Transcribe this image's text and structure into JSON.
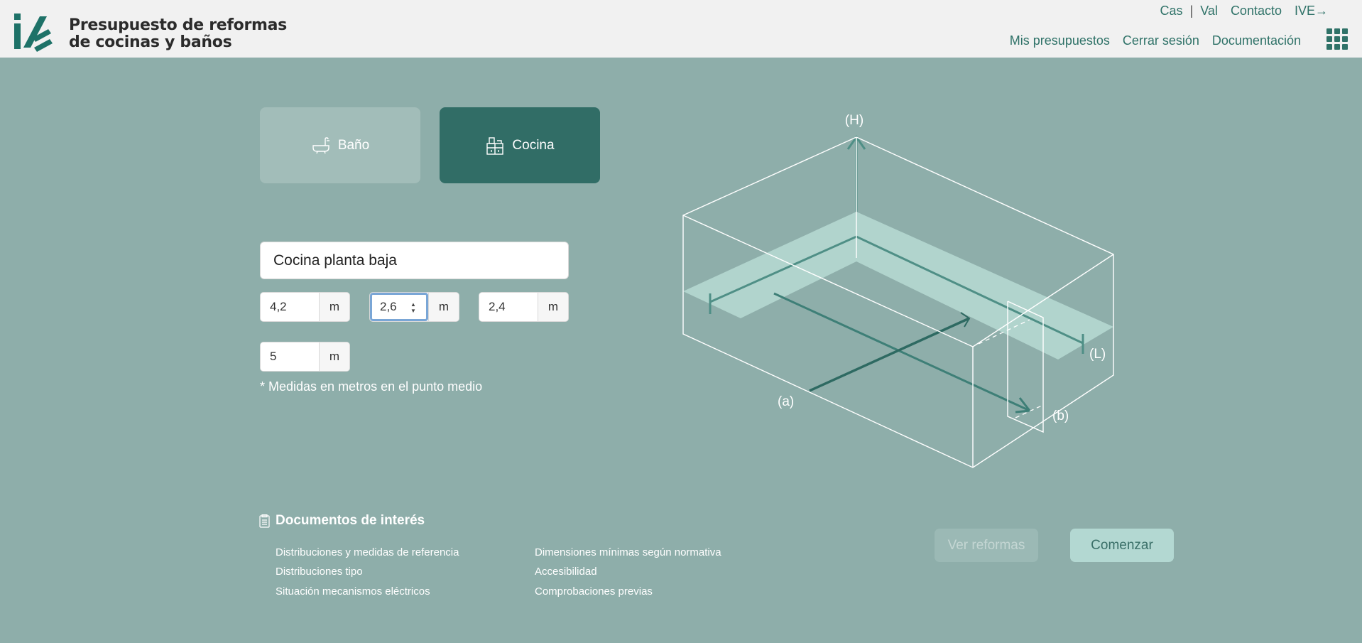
{
  "header": {
    "title_line1": "Presupuesto de reformas",
    "title_line2": "de cocinas y baños",
    "lang_cas": "Cas",
    "lang_sep": "|",
    "lang_val": "Val",
    "contacto": "Contacto",
    "ive": "IVE→",
    "nav": [
      "Mis presupuestos",
      "Cerrar sesión",
      "Documentación"
    ],
    "brand_color": "#2f7268"
  },
  "type_selector": {
    "bano_label": "Baño",
    "cocina_label": "Cocina",
    "selected": "Cocina"
  },
  "form": {
    "name_value": "Cocina planta baja",
    "dimensions": [
      {
        "value": "4,2",
        "unit": "m"
      },
      {
        "value": "2,6",
        "unit": "m"
      },
      {
        "value": "2,4",
        "unit": "m"
      },
      {
        "value": "5",
        "unit": "m"
      }
    ],
    "note": "* Medidas en metros en el punto medio"
  },
  "diagram": {
    "label_h": "(H)",
    "label_l": "(L)",
    "label_a": "(a)",
    "label_b": "(b)"
  },
  "documents": {
    "title": "Documentos de interés",
    "links_col1": [
      "Distribuciones y medidas de referencia",
      "Distribuciones tipo",
      "Situación mecanismos eléctricos"
    ],
    "links_col2": [
      "Dimensiones mínimas según normativa",
      "Accesibilidad",
      "Comprobaciones previas"
    ]
  },
  "actions": {
    "ver_reformas": "Ver reformas",
    "comenzar": "Comenzar"
  }
}
